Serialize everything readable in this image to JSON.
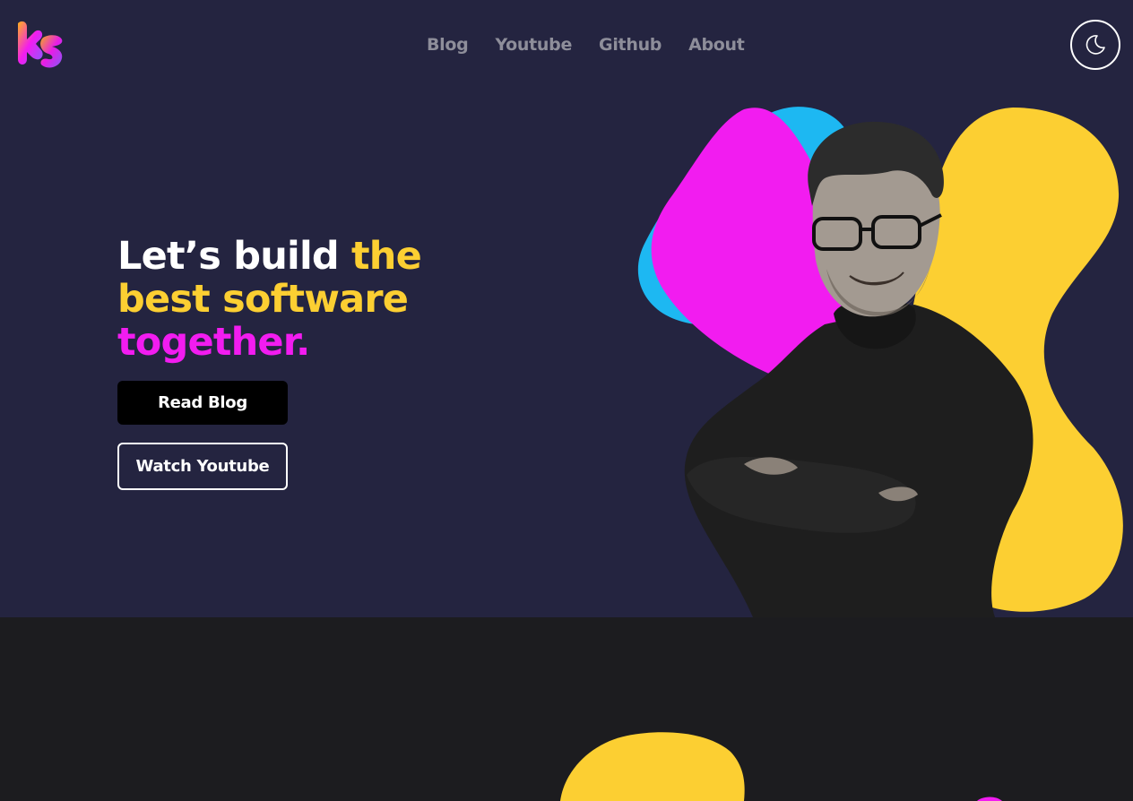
{
  "brand": {
    "logo_icon": "ks-logo-icon",
    "colors": {
      "hero_bg": "#242440",
      "page_bg": "#1c1c1f",
      "yellow": "#fccf32",
      "pink": "#f21cf0",
      "blue": "#1db8f2",
      "nav_text": "#8e8e9a"
    }
  },
  "nav": {
    "items": [
      {
        "label": "Blog"
      },
      {
        "label": "Youtube"
      },
      {
        "label": "Github"
      },
      {
        "label": "About"
      }
    ]
  },
  "theme_toggle": {
    "icon": "moon-icon"
  },
  "hero": {
    "headline": {
      "part1": "Let’s build ",
      "part2": "the best software",
      "part3": "together."
    },
    "read_blog_label": "Read Blog",
    "watch_youtube_label": "Watch Youtube",
    "portrait": "person-portrait"
  }
}
